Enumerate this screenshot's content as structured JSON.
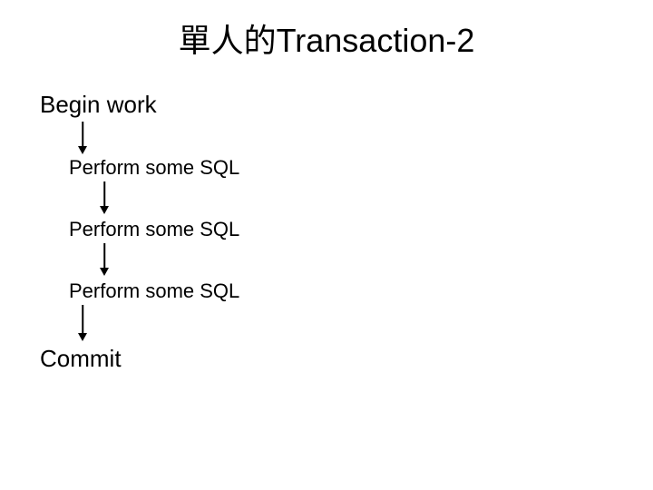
{
  "title": "單人的Transaction-2",
  "steps": {
    "begin": "Begin work",
    "sql1": "Perform some SQL",
    "sql2": "Perform some SQL",
    "sql3": "Perform some SQL",
    "commit": "Commit"
  }
}
